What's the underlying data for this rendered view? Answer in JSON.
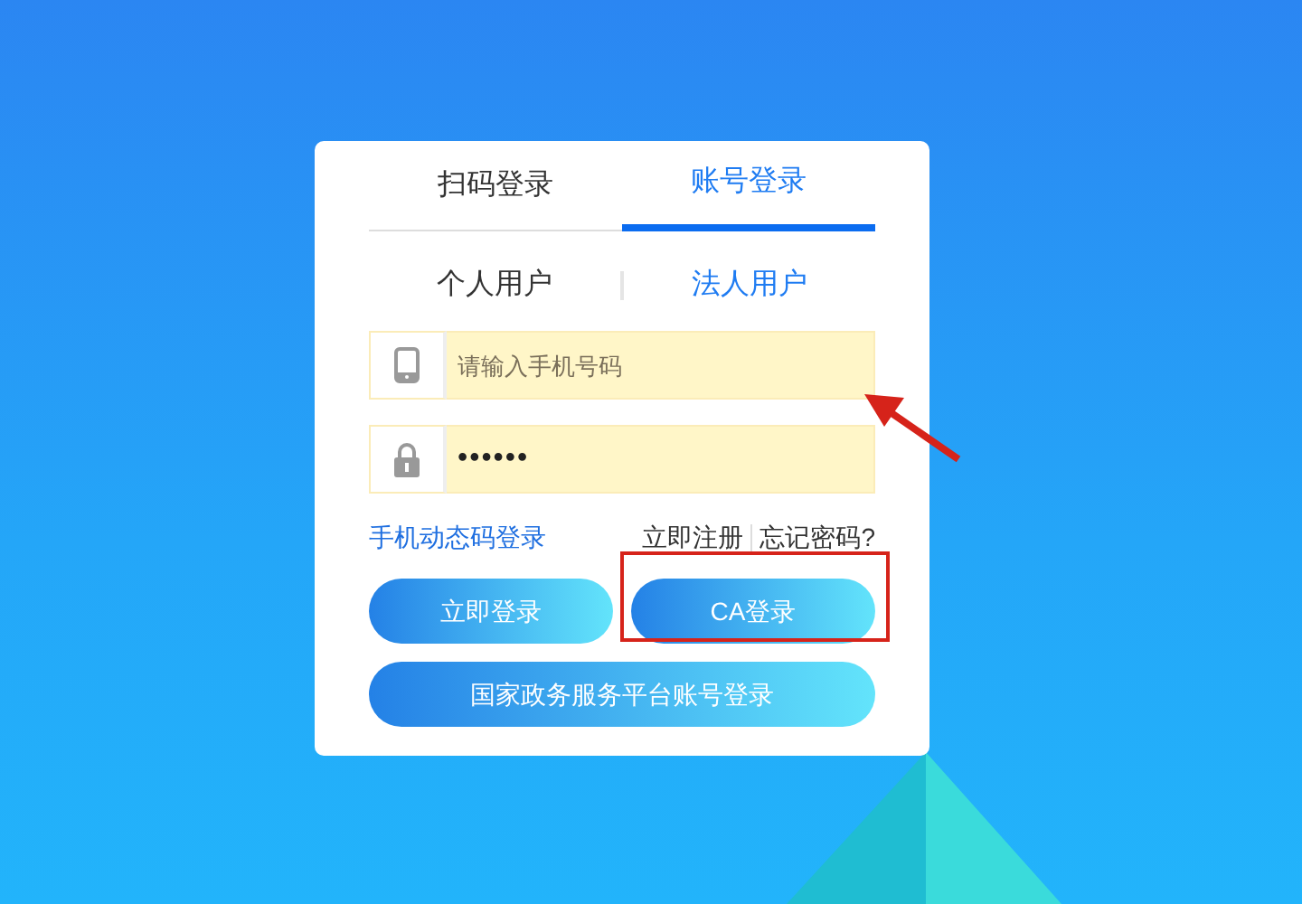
{
  "login_tabs": [
    {
      "label": "扫码登录",
      "selected": false
    },
    {
      "label": "账号登录",
      "selected": true
    }
  ],
  "user_types": [
    {
      "label": "个人用户",
      "selected": false
    },
    {
      "label": "法人用户",
      "selected": true
    }
  ],
  "fields": [
    {
      "kind": "phone",
      "placeholder": "请输入手机号码"
    },
    {
      "kind": "password",
      "value": "••••••"
    }
  ],
  "links": {
    "sms_login": "手机动态码登录",
    "register": "立即注册",
    "forgot": "忘记密码?"
  },
  "buttons": [
    {
      "label": "立即登录"
    },
    {
      "label": "CA登录"
    }
  ],
  "gov_button": "国家政务服务平台账号登录"
}
